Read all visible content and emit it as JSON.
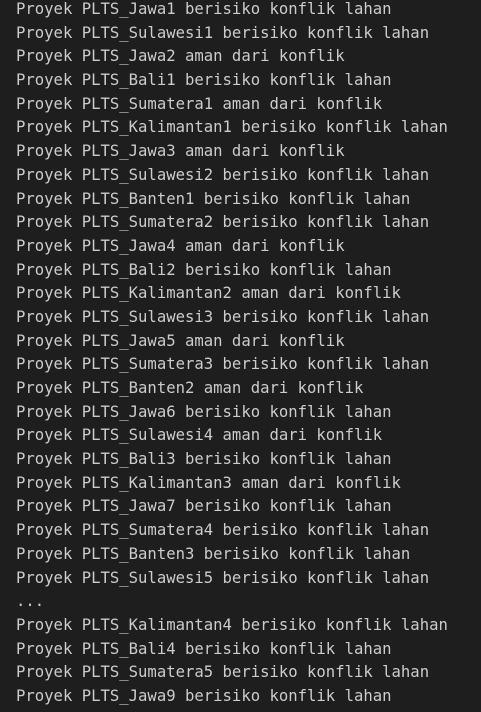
{
  "output": {
    "lines": [
      "Proyek PLTS_Jawa1 berisiko konflik lahan",
      "Proyek PLTS_Sulawesi1 berisiko konflik lahan",
      "Proyek PLTS_Jawa2 aman dari konflik",
      "Proyek PLTS_Bali1 berisiko konflik lahan",
      "Proyek PLTS_Sumatera1 aman dari konflik",
      "Proyek PLTS_Kalimantan1 berisiko konflik lahan",
      "Proyek PLTS_Jawa3 aman dari konflik",
      "Proyek PLTS_Sulawesi2 berisiko konflik lahan",
      "Proyek PLTS_Banten1 berisiko konflik lahan",
      "Proyek PLTS_Sumatera2 berisiko konflik lahan",
      "Proyek PLTS_Jawa4 aman dari konflik",
      "Proyek PLTS_Bali2 berisiko konflik lahan",
      "Proyek PLTS_Kalimantan2 aman dari konflik",
      "Proyek PLTS_Sulawesi3 berisiko konflik lahan",
      "Proyek PLTS_Jawa5 aman dari konflik",
      "Proyek PLTS_Sumatera3 berisiko konflik lahan",
      "Proyek PLTS_Banten2 aman dari konflik",
      "Proyek PLTS_Jawa6 berisiko konflik lahan",
      "Proyek PLTS_Sulawesi4 aman dari konflik",
      "Proyek PLTS_Bali3 berisiko konflik lahan",
      "Proyek PLTS_Kalimantan3 aman dari konflik",
      "Proyek PLTS_Jawa7 berisiko konflik lahan",
      "Proyek PLTS_Sumatera4 berisiko konflik lahan",
      "Proyek PLTS_Banten3 berisiko konflik lahan",
      "Proyek PLTS_Sulawesi5 berisiko konflik lahan",
      "...",
      "Proyek PLTS_Kalimantan4 berisiko konflik lahan",
      "Proyek PLTS_Bali4 berisiko konflik lahan",
      "Proyek PLTS_Sumatera5 berisiko konflik lahan",
      "Proyek PLTS_Jawa9 berisiko konflik lahan"
    ]
  }
}
